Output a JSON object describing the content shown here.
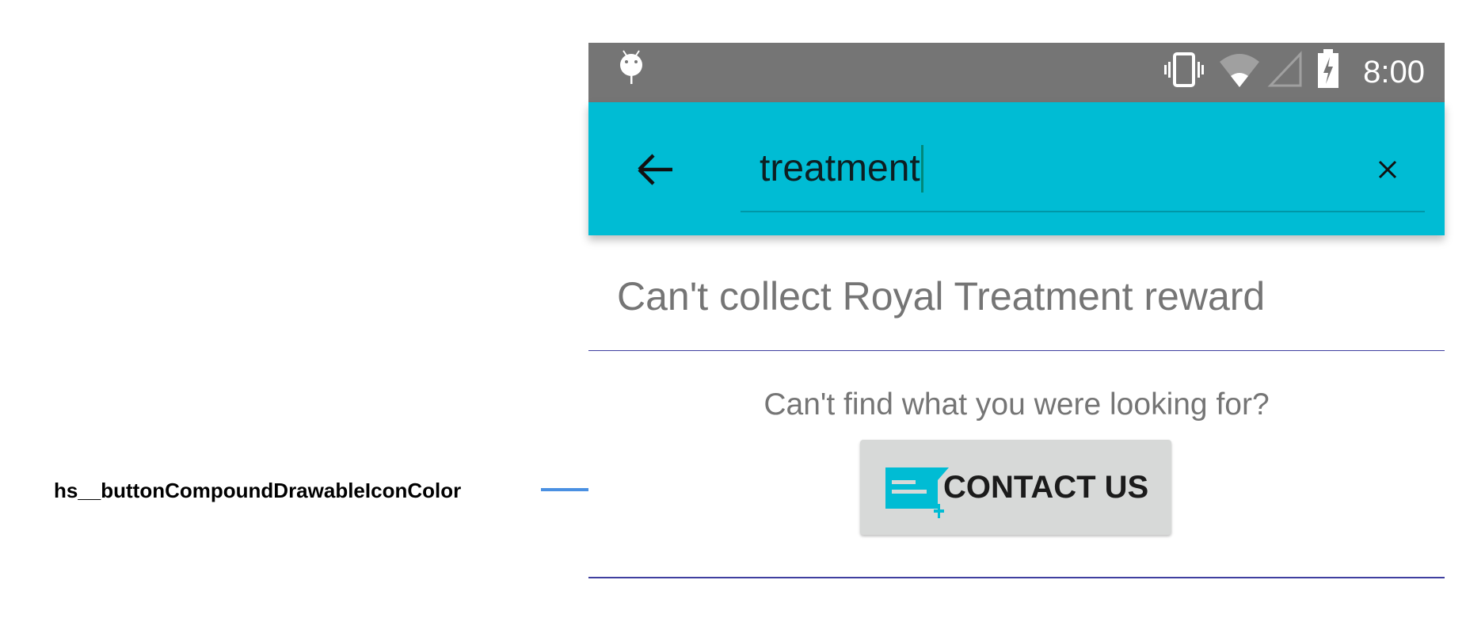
{
  "annotation": {
    "label": "hs__buttonCompoundDrawableIconColor",
    "line_color": "#4a90e2"
  },
  "status_bar": {
    "time": "8:00",
    "icons": [
      "android-debug-icon",
      "vibrate-icon",
      "wifi-icon",
      "cell-signal-icon",
      "battery-charging-icon"
    ],
    "color": "#757575"
  },
  "toolbar": {
    "color": "#00bcd4",
    "back_icon": "arrow-left-icon",
    "search_value": "treatment",
    "clear_icon": "close-icon"
  },
  "results": [
    {
      "title": "Can't collect Royal Treatment reward"
    }
  ],
  "footer": {
    "prompt": "Can't find what you were looking for?",
    "contact_button": {
      "label": "CONTACT US",
      "icon": "new-conversation-icon",
      "icon_color": "#00bcd4"
    }
  }
}
